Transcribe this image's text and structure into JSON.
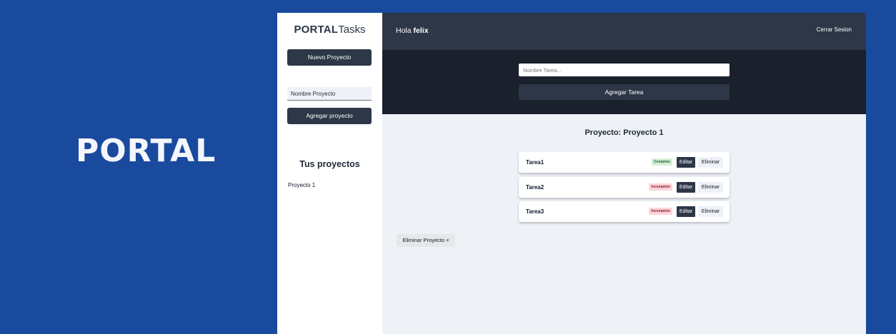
{
  "banner": {
    "title": "PORTAL"
  },
  "sidebar": {
    "logo_bold": "PORTAL",
    "logo_light": "Tasks",
    "new_project_label": "Nuevo Proyecto",
    "project_name_value": "Nombre Proyecto",
    "add_project_label": "Agregar proyecto",
    "projects_heading": "Tus proyectos",
    "projects": [
      "Proyecto 1"
    ]
  },
  "header": {
    "greeting": "Hola",
    "username": "felix",
    "logout_label": "Cerrar Sesion"
  },
  "task_form": {
    "task_name_placeholder": "Nombre Tarea...",
    "add_task_label": "Agregar Tarea"
  },
  "main": {
    "project_title": "Proyecto: Proyecto 1",
    "edit_label": "Editar",
    "delete_label": "Eliminar",
    "delete_project_label": "Eliminar Proyecto ×",
    "tasks": [
      {
        "name": "Tarea1",
        "status": "Completo"
      },
      {
        "name": "Tarea2",
        "status": "Incompleto"
      },
      {
        "name": "Tarea3",
        "status": "Incompleto"
      }
    ]
  },
  "colors": {
    "banner_bg": "#1a4a9e",
    "primary_dark": "#2d3748",
    "form_bg": "#1a202c",
    "content_bg": "#eef2f7",
    "badge_complete": "#d5f0d8",
    "badge_incomplete": "#fbd5d9"
  }
}
